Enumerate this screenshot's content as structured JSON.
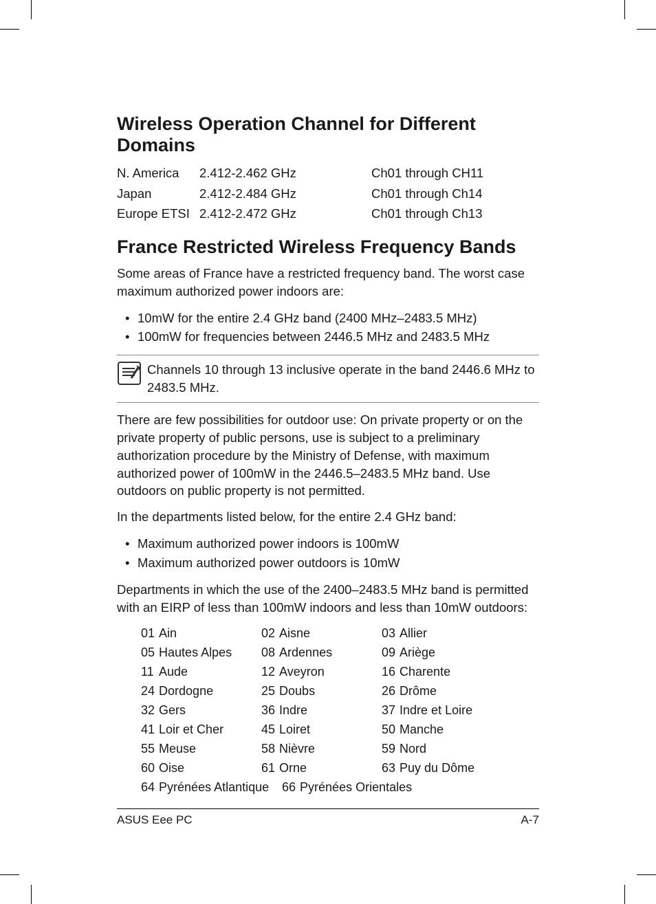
{
  "headings": {
    "h1a": "Wireless Operation Channel for Different Domains",
    "h1b": "France Restricted Wireless Frequency Bands"
  },
  "channels": {
    "rows": [
      {
        "region": "N. America",
        "freq": "2.412-2.462 GHz",
        "ch": "Ch01 through CH11"
      },
      {
        "region": "Japan",
        "freq": "2.412-2.484 GHz",
        "ch": "Ch01 through Ch14"
      },
      {
        "region": "Europe ETSI",
        "freq": "2.412-2.472 GHz",
        "ch": "Ch01 through Ch13"
      }
    ]
  },
  "para": {
    "p1": "Some areas of France have a restricted frequency band. The worst case maximum authorized power indoors are:",
    "b1": "10mW for the entire 2.4 GHz band (2400 MHz–2483.5 MHz)",
    "b2": "100mW for frequencies between 2446.5 MHz and 2483.5 MHz",
    "note": "Channels 10 through 13 inclusive operate in the band 2446.6 MHz to 2483.5 MHz.",
    "p2": "There are few possibilities for outdoor use: On private property or on the private property of public persons, use is subject to a preliminary authorization procedure by the Ministry of Defense, with maximum authorized power of 100mW in the 2446.5–2483.5 MHz band. Use outdoors on public property is not permitted.",
    "p3": "In the departments listed below, for the entire 2.4 GHz band:",
    "b3": "Maximum authorized power indoors is 100mW",
    "b4": "Maximum authorized power outdoors is 10mW",
    "p4": "Departments in which the use of the 2400–2483.5 MHz band is permitted with an EIRP of less than 100mW indoors and less than 10mW outdoors:"
  },
  "depts": {
    "rows": [
      [
        {
          "n": "01",
          "name": "Ain"
        },
        {
          "n": "02",
          "name": "Aisne"
        },
        {
          "n": "03",
          "name": "Allier"
        }
      ],
      [
        {
          "n": "05",
          "name": "Hautes Alpes"
        },
        {
          "n": "08",
          "name": "Ardennes"
        },
        {
          "n": "09",
          "name": "Ariège"
        }
      ],
      [
        {
          "n": "11",
          "name": "Aude"
        },
        {
          "n": "12",
          "name": "Aveyron"
        },
        {
          "n": "16",
          "name": "Charente"
        }
      ],
      [
        {
          "n": "24",
          "name": "Dordogne"
        },
        {
          "n": "25",
          "name": "Doubs"
        },
        {
          "n": "26",
          "name": "Drôme"
        }
      ],
      [
        {
          "n": "32",
          "name": "Gers"
        },
        {
          "n": "36",
          "name": "Indre"
        },
        {
          "n": "37",
          "name": "Indre et Loire"
        }
      ],
      [
        {
          "n": "41",
          "name": "Loir et Cher"
        },
        {
          "n": "45",
          "name": "Loiret"
        },
        {
          "n": "50",
          "name": "Manche"
        }
      ],
      [
        {
          "n": "55",
          "name": "Meuse"
        },
        {
          "n": "58",
          "name": "Nièvre"
        },
        {
          "n": "59",
          "name": "Nord"
        }
      ],
      [
        {
          "n": "60",
          "name": "Oise"
        },
        {
          "n": "61",
          "name": "Orne"
        },
        {
          "n": "63",
          "name": "Puy du Dôme"
        }
      ],
      [
        {
          "n": "64",
          "name": "Pyrénées Atlantique"
        },
        {
          "n": "66",
          "name": "Pyrénées Orientales"
        }
      ]
    ]
  },
  "footer": {
    "left": "ASUS Eee PC",
    "right": "A-7"
  }
}
